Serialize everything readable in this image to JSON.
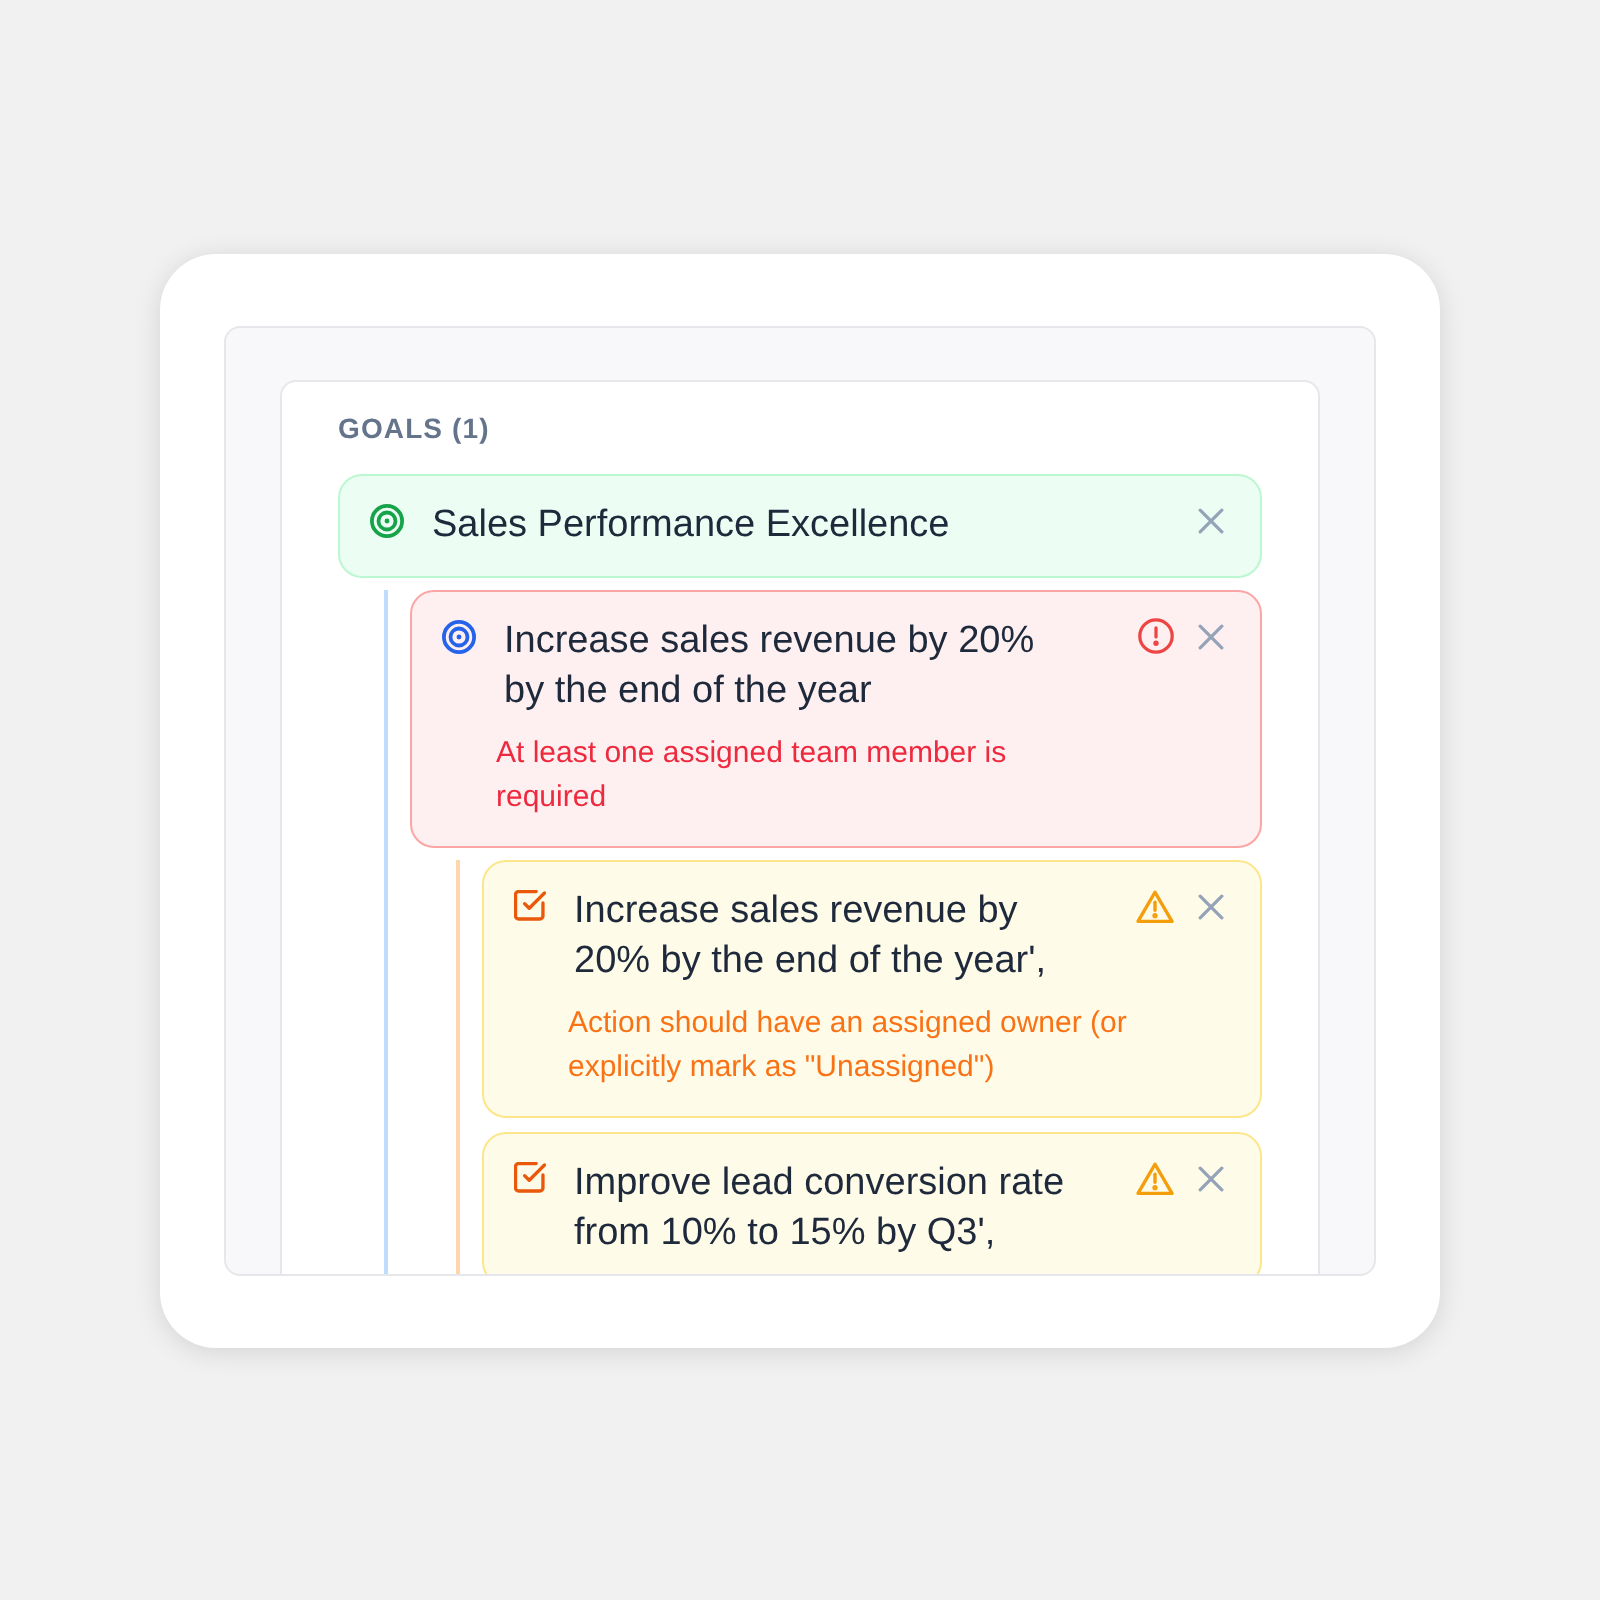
{
  "section": {
    "title": "GOALS (1)"
  },
  "goals": [
    {
      "kind": "goal",
      "title": "Sales Performance Excellence",
      "children": [
        {
          "kind": "objective",
          "title": "Increase sales revenue by 20% by the end of the year",
          "issue": {
            "kind": "error",
            "message": "At least one assigned team member is required"
          },
          "children": [
            {
              "kind": "action",
              "title": "Increase sales revenue by 20% by the end of the year',",
              "issue": {
                "kind": "warning",
                "message": "Action should have an assigned owner (or explicitly mark as \"Unassigned\")"
              }
            },
            {
              "kind": "action",
              "title": "Improve lead conversion rate from 10% to 15% by Q3',",
              "issue": {
                "kind": "warning"
              }
            }
          ]
        }
      ]
    }
  ]
}
